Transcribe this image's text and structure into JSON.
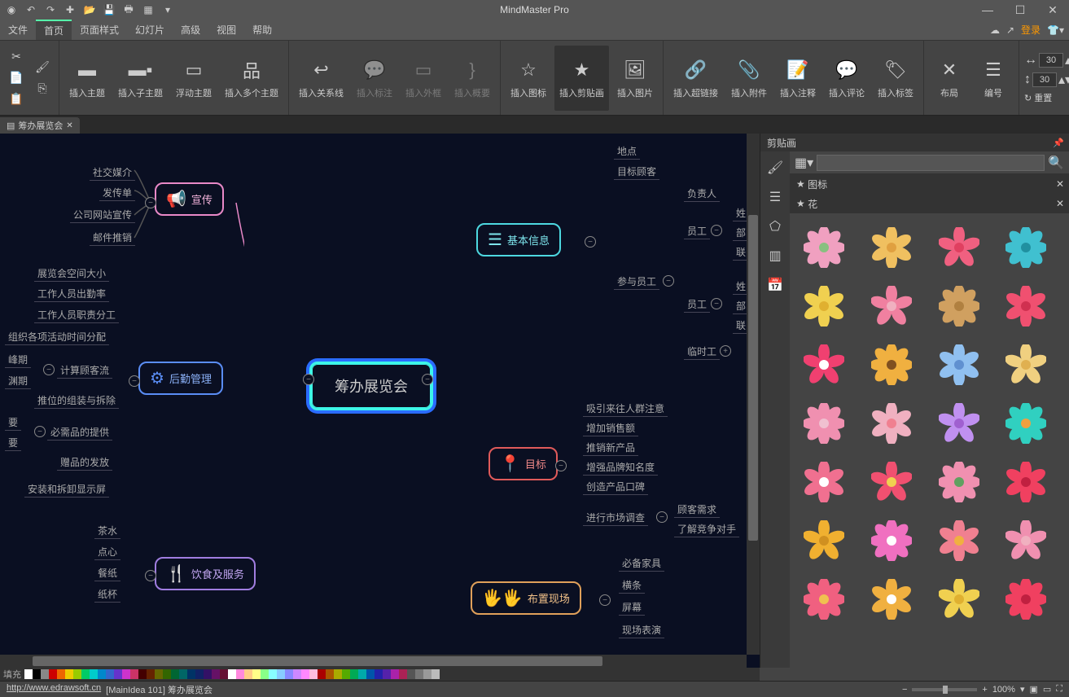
{
  "window": {
    "title": "MindMaster Pro"
  },
  "menu": {
    "items": [
      "文件",
      "首页",
      "页面样式",
      "幻灯片",
      "高级",
      "视图",
      "帮助"
    ],
    "active_index": 1,
    "login": "登录"
  },
  "ribbon": {
    "clipboard_tip": "剪切/格式刷/粘贴",
    "groups": [
      {
        "id": "theme",
        "buttons": [
          {
            "label": "插入主题",
            "icon": "◼"
          },
          {
            "label": "插入子主题",
            "icon": "◼◾"
          },
          {
            "label": "浮动主题",
            "icon": "◻"
          },
          {
            "label": "插入多个主题",
            "icon": "品"
          }
        ]
      },
      {
        "id": "relation",
        "buttons": [
          {
            "label": "插入关系线",
            "icon": "↩"
          },
          {
            "label": "插入标注",
            "icon": "💬",
            "disabled": true
          },
          {
            "label": "插入外框",
            "icon": "▭",
            "disabled": true
          },
          {
            "label": "插入概要",
            "icon": "☰",
            "disabled": true
          }
        ]
      },
      {
        "id": "picture",
        "buttons": [
          {
            "label": "插入图标",
            "icon": "☆"
          },
          {
            "label": "插入剪贴画",
            "icon": "★",
            "active": true
          },
          {
            "label": "插入图片",
            "icon": "🖼"
          }
        ]
      },
      {
        "id": "attach",
        "buttons": [
          {
            "label": "插入超链接",
            "icon": "🔗"
          },
          {
            "label": "插入附件",
            "icon": "📎"
          },
          {
            "label": "插入注释",
            "icon": "📝"
          },
          {
            "label": "插入评论",
            "icon": "💬"
          },
          {
            "label": "插入标签",
            "icon": "🏷"
          }
        ]
      },
      {
        "id": "layout",
        "buttons": [
          {
            "label": "布局",
            "icon": "✕"
          },
          {
            "label": "编号",
            "icon": "☰"
          }
        ]
      }
    ],
    "width_value": "30",
    "height_value": "30",
    "reset": "重置"
  },
  "document": {
    "tab_name": "筹办展览会"
  },
  "mindmap": {
    "central": "筹办展览会",
    "nodes": {
      "n_info": "基本信息",
      "n_xc": "宣传",
      "n_hq": "后勤管理",
      "n_ys": "饮食及服务",
      "n_mb": "目标",
      "n_bz": "布置现场"
    },
    "leaves": {
      "l1": "社交媒介",
      "l2": "发传单",
      "l3": "公司网站宣传",
      "l4": "邮件推销",
      "l5": "展览会空间大小",
      "l6": "工作人员出勤率",
      "l7": "工作人员职责分工",
      "l8": "组织各项活动时间分配",
      "l9": "峰期",
      "l10": "渊期",
      "l11": "计算顾客流",
      "l12": "推位的组装与拆除",
      "l13": "要",
      "l14": "要",
      "l15": "必需品的提供",
      "l16": "赠品的发放",
      "l17": "安装和拆卸显示屏",
      "l18": "茶水",
      "l19": "点心",
      "l20": "餐纸",
      "l21": "纸杯",
      "l22": "地点",
      "l23": "目标顾客",
      "l24": "负责人",
      "l25": "员工",
      "l26": "姓",
      "l27": "部门",
      "l28": "联",
      "l29": "参与员工",
      "l30": "员工",
      "l31": "姓",
      "l32": "部门",
      "l33": "联",
      "l34": "临时工",
      "l35": "吸引来往人群注意",
      "l36": "增加销售额",
      "l37": "推销新产品",
      "l38": "增强品牌知名度",
      "l39": "创造产品口碑",
      "l40": "进行市场调查",
      "l41": "顾客需求",
      "l42": "了解竞争对手",
      "l43": "必备家具",
      "l44": "横条",
      "l45": "屏幕",
      "l46": "现场表演"
    }
  },
  "rightpanel": {
    "title": "剪贴画",
    "section_icon": "图标",
    "section_flower": "花"
  },
  "palette": {
    "label": "填充"
  },
  "status": {
    "url": "http://www.edrawsoft.cn",
    "doc_info": "[MainIdea 101]  筹办展览会",
    "zoom": "100%"
  },
  "flower_colors": [
    [
      "#f0a0c0",
      "#88c080"
    ],
    [
      "#f0c060",
      "#e0a040"
    ],
    [
      "#f06080",
      "#e04060"
    ],
    [
      "#40c0d0",
      "#2090a0"
    ],
    [
      "#f0d050",
      "#e0b030"
    ],
    [
      "#f080a0",
      "#f0b0c0"
    ],
    [
      "#d0a060",
      "#b08040"
    ],
    [
      "#f05070",
      "#d03050"
    ],
    [
      "#f04070",
      "#ffffff"
    ],
    [
      "#f0b040",
      "#805020"
    ],
    [
      "#90c0f0",
      "#6090d0"
    ],
    [
      "#f0d080",
      "#e0b050"
    ],
    [
      "#f090b0",
      "#f0c0d0"
    ],
    [
      "#f0b0c0",
      "#f08090"
    ],
    [
      "#c090f0",
      "#a060d0"
    ],
    [
      "#30d0c0",
      "#f0a040"
    ],
    [
      "#f07090",
      "#ffffff"
    ],
    [
      "#f05070",
      "#f0d050"
    ],
    [
      "#f090b0",
      "#60a060"
    ],
    [
      "#f04060",
      "#c02040"
    ],
    [
      "#f0b030",
      "#d09020"
    ],
    [
      "#f070c0",
      "#ffffff"
    ],
    [
      "#f08090",
      "#f0b040"
    ],
    [
      "#f090b0",
      "#f0b0c0"
    ],
    [
      "#f06080",
      "#f0c050"
    ],
    [
      "#f0b040",
      "#ffffff"
    ],
    [
      "#f0d050",
      "#e0b030"
    ],
    [
      "#f04060",
      "#c02040"
    ]
  ]
}
